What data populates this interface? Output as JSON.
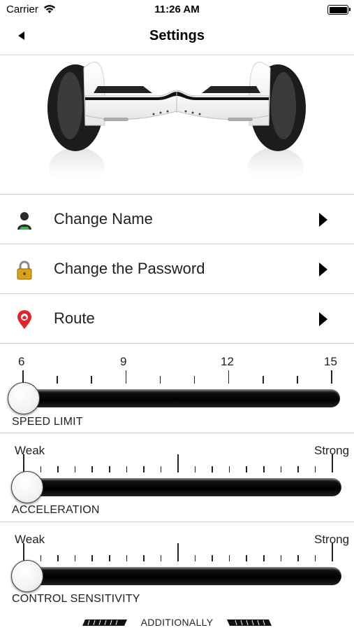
{
  "status_bar": {
    "carrier": "Carrier",
    "time": "11:26 AM"
  },
  "nav": {
    "title": "Settings"
  },
  "menu": [
    {
      "label": "Change Name",
      "icon": "user-icon"
    },
    {
      "label": "Change the Password",
      "icon": "lock-icon"
    },
    {
      "label": "Route",
      "icon": "map-pin-icon"
    }
  ],
  "speed": {
    "caption": "SPEED LIMIT",
    "tick_labels": [
      "6",
      "9",
      "12",
      "15"
    ],
    "min": 6,
    "max": 15,
    "value": 6
  },
  "acceleration": {
    "caption": "ACCELERATION",
    "low_label": "Weak",
    "high_label": "Strong",
    "value": 0
  },
  "sensitivity": {
    "caption": "CONTROL SENSITIVITY",
    "low_label": "Weak",
    "high_label": "Strong",
    "value": 0
  },
  "footer": {
    "label": "ADDITIONALLY"
  },
  "colors": {
    "track": "#000000",
    "divider": "#cfcfcf",
    "pin": "#e0262b",
    "lock": "#d9a21a"
  }
}
